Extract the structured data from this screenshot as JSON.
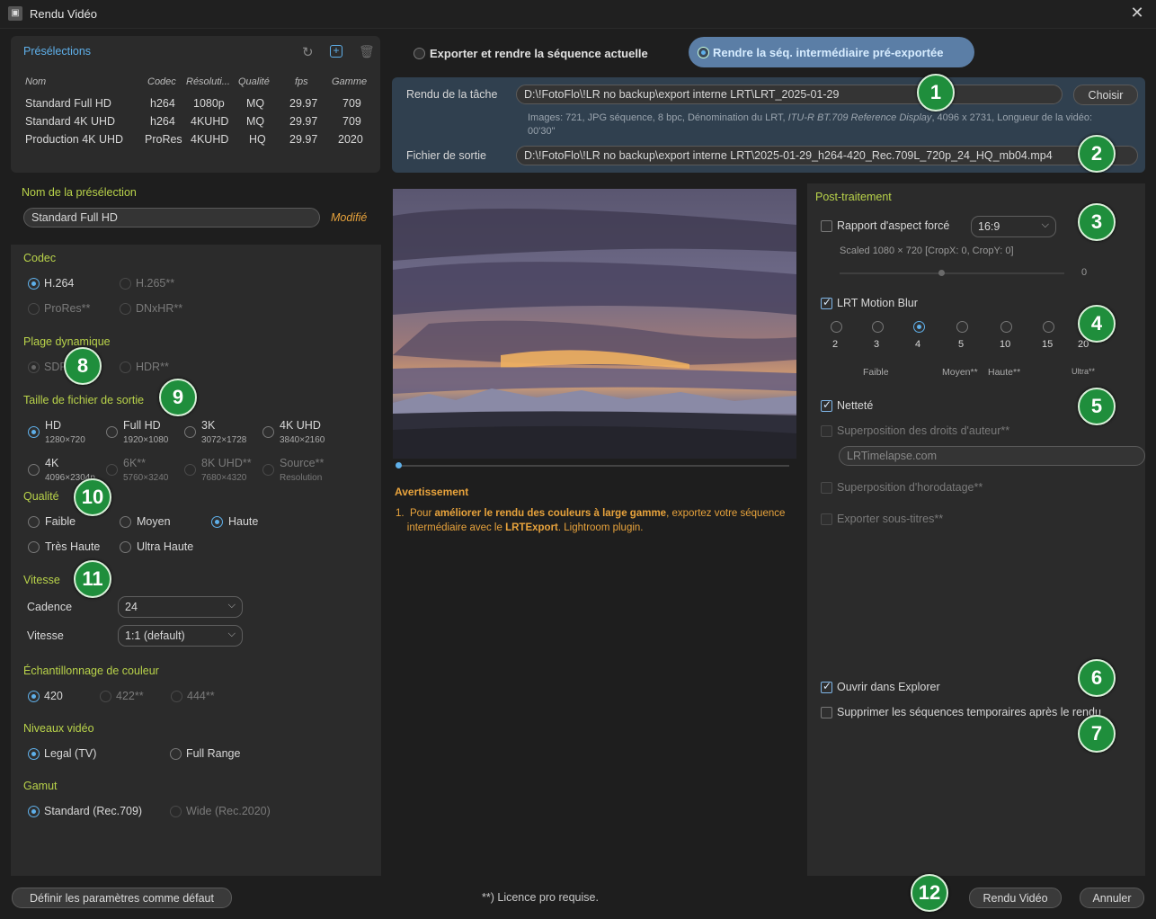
{
  "window": {
    "title": "Rendu Vidéo",
    "close_icon": "close-icon"
  },
  "presets": {
    "title": "Présélections",
    "headers": [
      "Nom",
      "Codec",
      "Résoluti...",
      "Qualité",
      "fps",
      "Gamme"
    ],
    "rows": [
      [
        "Standard Full HD",
        "h264",
        "1080p",
        "MQ",
        "29.97",
        "709"
      ],
      [
        "Standard 4K UHD",
        "h264",
        "4KUHD",
        "MQ",
        "29.97",
        "709"
      ],
      [
        "Production 4K UHD",
        "ProRes",
        "4KUHD",
        "HQ",
        "29.97",
        "2020"
      ]
    ],
    "name_label": "Nom de la présélection",
    "name_value": "Standard Full HD",
    "modified": "Modifié"
  },
  "mode": {
    "export_label": "Exporter et rendre la séquence actuelle",
    "render_label": "Rendre la séq. intermédiaire pré-exportée"
  },
  "task": {
    "label": "Rendu de la tâche",
    "path": "D:\\!FotoFlo\\!LR no backup\\export interne LRT\\LRT_2025-01-29",
    "choose": "Choisir",
    "info_a": "Images: 721, JPG séquence, 8 bpc, Dénomination du LRT,",
    "info_b": "ITU-R BT.709 Reference Display",
    "info_c": ", 4096 x 2731, Longueur de la vidéo:",
    "info_d": "00'30\"",
    "output_label": "Fichier de sortie",
    "output_path": "D:\\!FotoFlo\\!LR no backup\\export interne LRT\\2025-01-29_h264-420_Rec.709L_720p_24_HQ_mb04.mp4"
  },
  "codec": {
    "title": "Codec",
    "options": [
      "H.264",
      "H.265**",
      "ProRes**",
      "DNxHR**"
    ]
  },
  "dynamic_range": {
    "title": "Plage dynamique",
    "options": [
      "SDR",
      "HDR**"
    ]
  },
  "output_size": {
    "title": "Taille de fichier de sortie",
    "options": [
      {
        "label": "HD",
        "sub": "1280×720"
      },
      {
        "label": "Full HD",
        "sub": "1920×1080"
      },
      {
        "label": "3K",
        "sub": "3072×1728"
      },
      {
        "label": "4K UHD",
        "sub": "3840×2160"
      },
      {
        "label": "4K",
        "sub": "4096×2304p"
      },
      {
        "label": "6K**",
        "sub": "5760×3240"
      },
      {
        "label": "8K UHD**",
        "sub": "7680×4320"
      },
      {
        "label": "Source**",
        "sub": "Resolution"
      }
    ]
  },
  "quality": {
    "title": "Qualité",
    "options": [
      "Faible",
      "Moyen",
      "Haute",
      "Très Haute",
      "Ultra Haute"
    ]
  },
  "speed": {
    "title": "Vitesse",
    "cadence_label": "Cadence",
    "cadence_value": "24",
    "speed_label": "Vitesse",
    "speed_value": "1:1 (default)"
  },
  "chroma": {
    "title": "Échantillonnage de couleur",
    "options": [
      "420",
      "422**",
      "444**"
    ]
  },
  "levels": {
    "title": "Niveaux vidéo",
    "options": [
      "Legal (TV)",
      "Full Range"
    ]
  },
  "gamut": {
    "title": "Gamut",
    "options": [
      "Standard (Rec.709)",
      "Wide (Rec.2020)"
    ]
  },
  "warning": {
    "title": "Avertissement",
    "num": "1.",
    "t1": "Pour ",
    "b1": "améliorer le rendu des couleurs à large gamme",
    "t2": ", exportez votre séquence",
    "t3": "intermédiaire avec le ",
    "b2": "LRTExport",
    "t4": ". Lightroom plugin."
  },
  "post": {
    "title": "Post-traitement",
    "aspect_label": "Rapport d'aspect forcé",
    "aspect_value": "16:9",
    "scaled": "Scaled 1080 × 720 [CropX: 0, CropY: 0]",
    "slider_value": "0",
    "slider_level": 0.45,
    "motion_blur": "LRT Motion Blur",
    "blur_values": [
      "2",
      "3",
      "4",
      "5",
      "10",
      "15",
      "20"
    ],
    "blur_labels": [
      "Faible",
      "Moyen**",
      "Haute**",
      "Ultra**"
    ],
    "sharpness": "Netteté",
    "copyright": "Superposition des droits d'auteur**",
    "copyright_value": "LRTimelapse.com",
    "timestamp": "Superposition d'horodatage**",
    "subtitles": "Exporter sous-titres**",
    "open_explorer": "Ouvrir dans Explorer",
    "delete_temp": "Supprimer les séquences temporaires après le rendu"
  },
  "footer": {
    "defaults": "Définir les paramètres comme défaut",
    "license": "**) Licence pro requise.",
    "render": "Rendu Vidéo",
    "cancel": "Annuler"
  },
  "badges": [
    "1",
    "2",
    "3",
    "4",
    "5",
    "6",
    "7",
    "8",
    "9",
    "10",
    "11",
    "12"
  ],
  "colors": {
    "accent": "#b9d34a",
    "blue": "#5fb0ea",
    "badge": "#1f8e3c",
    "warning": "#e8a33c"
  }
}
